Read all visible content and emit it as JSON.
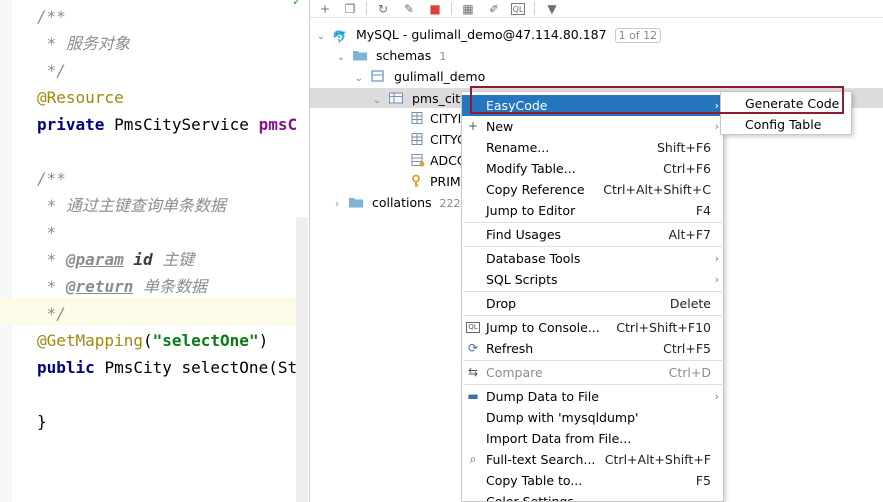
{
  "editor": {
    "lines": [
      {
        "parts": [
          {
            "c": "c-com",
            "t": "/**"
          }
        ]
      },
      {
        "parts": [
          {
            "c": "c-com",
            "t": " * 服务对象"
          }
        ]
      },
      {
        "parts": [
          {
            "c": "c-com",
            "t": " */"
          }
        ]
      },
      {
        "parts": [
          {
            "c": "c-ann",
            "t": "@Resource"
          }
        ]
      },
      {
        "parts": [
          {
            "c": "c-kw",
            "t": "private "
          },
          {
            "c": "c-plain",
            "t": "PmsCityService "
          },
          {
            "c": "c-fld",
            "t": "pmsC"
          }
        ]
      },
      {
        "parts": []
      },
      {
        "parts": [
          {
            "c": "c-com",
            "t": "/**"
          }
        ]
      },
      {
        "parts": [
          {
            "c": "c-com",
            "t": " * 通过主键查询单条数据"
          }
        ]
      },
      {
        "parts": [
          {
            "c": "c-com",
            "t": " *"
          }
        ]
      },
      {
        "parts": [
          {
            "c": "c-com",
            "t": " * "
          },
          {
            "c": "c-tag",
            "t": "@param"
          },
          {
            "c": "c-com",
            "t": " "
          },
          {
            "c": "c-par",
            "t": "id"
          },
          {
            "c": "c-com",
            "t": " 主键"
          }
        ]
      },
      {
        "parts": [
          {
            "c": "c-com",
            "t": " * "
          },
          {
            "c": "c-tag",
            "t": "@return"
          },
          {
            "c": "c-com",
            "t": " 单条数据"
          }
        ]
      },
      {
        "parts": [
          {
            "c": "c-com",
            "t": " */"
          }
        ]
      },
      {
        "parts": [
          {
            "c": "c-ann",
            "t": "@GetMapping"
          },
          {
            "c": "c-plain",
            "t": "("
          },
          {
            "c": "c-str",
            "t": "\"selectOne\""
          },
          {
            "c": "c-plain",
            "t": ")"
          }
        ]
      },
      {
        "parts": [
          {
            "c": "c-kw",
            "t": "public "
          },
          {
            "c": "c-plain",
            "t": "PmsCity selectOne(St"
          }
        ]
      },
      {
        "parts": []
      },
      {
        "parts": [
          {
            "c": "c-plain",
            "t": "}"
          }
        ]
      }
    ]
  },
  "tree": {
    "connection": {
      "label": "MySQL - gulimall_demo@47.114.80.187",
      "badge": "1 of 12"
    },
    "schemas": {
      "label": "schemas",
      "count": "1"
    },
    "schema": {
      "label": "gulimall_demo"
    },
    "table": {
      "label": "pms_city"
    },
    "children": [
      {
        "label": "CITYI",
        "icon": "column-icon"
      },
      {
        "label": "CITYC",
        "icon": "column-icon"
      },
      {
        "label": "ADCO",
        "icon": "index-icon"
      },
      {
        "label": "PRIM",
        "icon": "key-icon"
      }
    ],
    "collations": {
      "label": "collations",
      "count": "222"
    }
  },
  "context_menu": {
    "items": [
      {
        "label": "EasyCode",
        "submenu": true,
        "selected": true,
        "icon": ""
      },
      {
        "label": "New",
        "submenu": true,
        "icon": "plus-icon"
      },
      {
        "label": "Rename...",
        "shortcut": "Shift+F6"
      },
      {
        "label": "Modify Table...",
        "shortcut": "Ctrl+F6"
      },
      {
        "label": "Copy Reference",
        "shortcut": "Ctrl+Alt+Shift+C"
      },
      {
        "label": "Jump to Editor",
        "shortcut": "F4"
      },
      {
        "sep": true
      },
      {
        "label": "Find Usages",
        "shortcut": "Alt+F7"
      },
      {
        "sep": true
      },
      {
        "label": "Database Tools",
        "submenu": true
      },
      {
        "label": "SQL Scripts",
        "submenu": true
      },
      {
        "sep": true
      },
      {
        "label": "Drop",
        "shortcut": "Delete"
      },
      {
        "sep": true
      },
      {
        "label": "Jump to Console...",
        "shortcut": "Ctrl+Shift+F10",
        "icon": "console-icon"
      },
      {
        "label": "Refresh",
        "shortcut": "Ctrl+F5",
        "icon": "refresh-icon"
      },
      {
        "sep": true
      },
      {
        "label": "Compare",
        "shortcut": "Ctrl+D",
        "disabled": true,
        "icon": "compare-icon"
      },
      {
        "sep": true
      },
      {
        "label": "Dump Data to File",
        "submenu": true,
        "icon": "dump-icon"
      },
      {
        "label": "Dump with 'mysqldump'"
      },
      {
        "label": "Import Data from File..."
      },
      {
        "label": "Full-text Search...",
        "shortcut": "Ctrl+Alt+Shift+F",
        "icon": "search-icon"
      },
      {
        "label": "Copy Table to...",
        "shortcut": "F5"
      },
      {
        "label": "Color Settings..."
      }
    ]
  },
  "submenu": {
    "items": [
      {
        "label": "Generate Code"
      },
      {
        "label": "Config Table"
      }
    ]
  },
  "colors": {
    "selection": "#2675bf",
    "highlight_box": "#8e1b2f"
  }
}
